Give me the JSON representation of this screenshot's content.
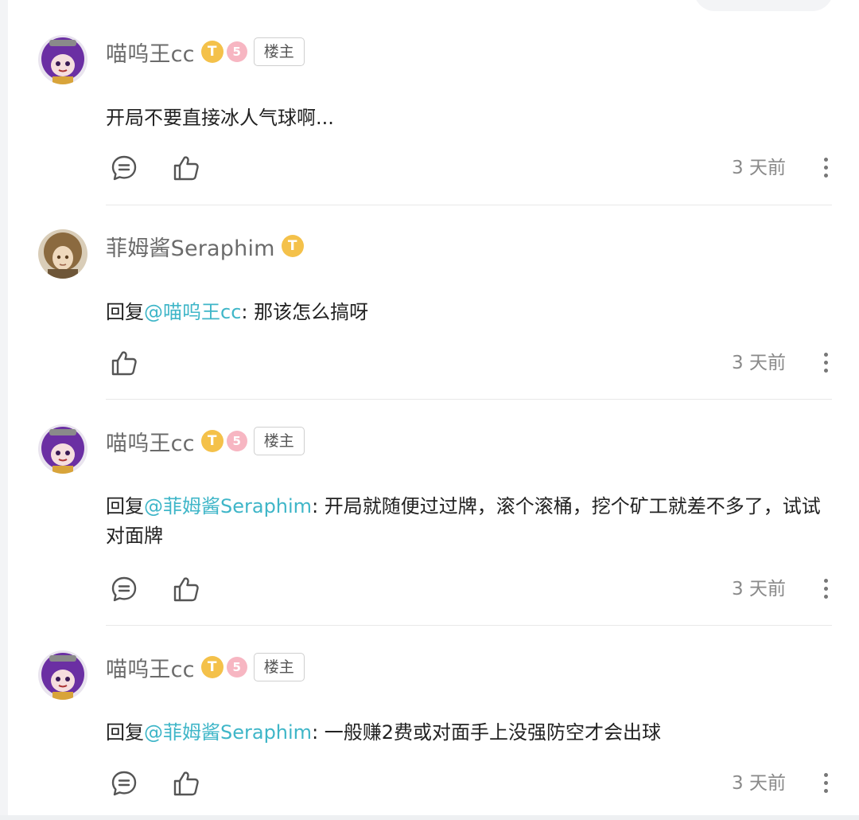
{
  "comments": [
    {
      "username": "喵呜王cc",
      "avatar": "purple-hair-avatar",
      "badges": [
        "gold-coin-badge",
        "pink-badge"
      ],
      "op_tag": "楼主",
      "reply_prefix": "",
      "mention": "",
      "text": "开局不要直接冰人气球啊...",
      "time": "3 天前",
      "has_reply_button": true
    },
    {
      "username": "菲姆酱Seraphim",
      "avatar": "brown-hair-avatar",
      "badges": [
        "gold-coin-badge"
      ],
      "op_tag": "",
      "reply_prefix": "回复",
      "mention": "@喵呜王cc",
      "text": ": 那该怎么搞呀",
      "time": "3 天前",
      "has_reply_button": false
    },
    {
      "username": "喵呜王cc",
      "avatar": "purple-hair-avatar",
      "badges": [
        "gold-coin-badge",
        "pink-badge"
      ],
      "op_tag": "楼主",
      "reply_prefix": "回复",
      "mention": "@菲姆酱Seraphim",
      "text": ": 开局就随便过过牌，滚个滚桶，挖个矿工就差不多了，试试对面牌",
      "time": "3 天前",
      "has_reply_button": true
    },
    {
      "username": "喵呜王cc",
      "avatar": "purple-hair-avatar",
      "badges": [
        "gold-coin-badge",
        "pink-badge"
      ],
      "op_tag": "楼主",
      "reply_prefix": "回复",
      "mention": "@菲姆酱Seraphim",
      "text": ": 一般赚2费或对面手上没强防空才会出球",
      "time": "3 天前",
      "has_reply_button": true
    }
  ],
  "colors": {
    "mention": "#3fb6c8",
    "username": "#6b6b6b",
    "timestamp": "#8a8a8a",
    "coin_badge": "#f4c14a",
    "pink_badge": "#f7b6c2"
  }
}
